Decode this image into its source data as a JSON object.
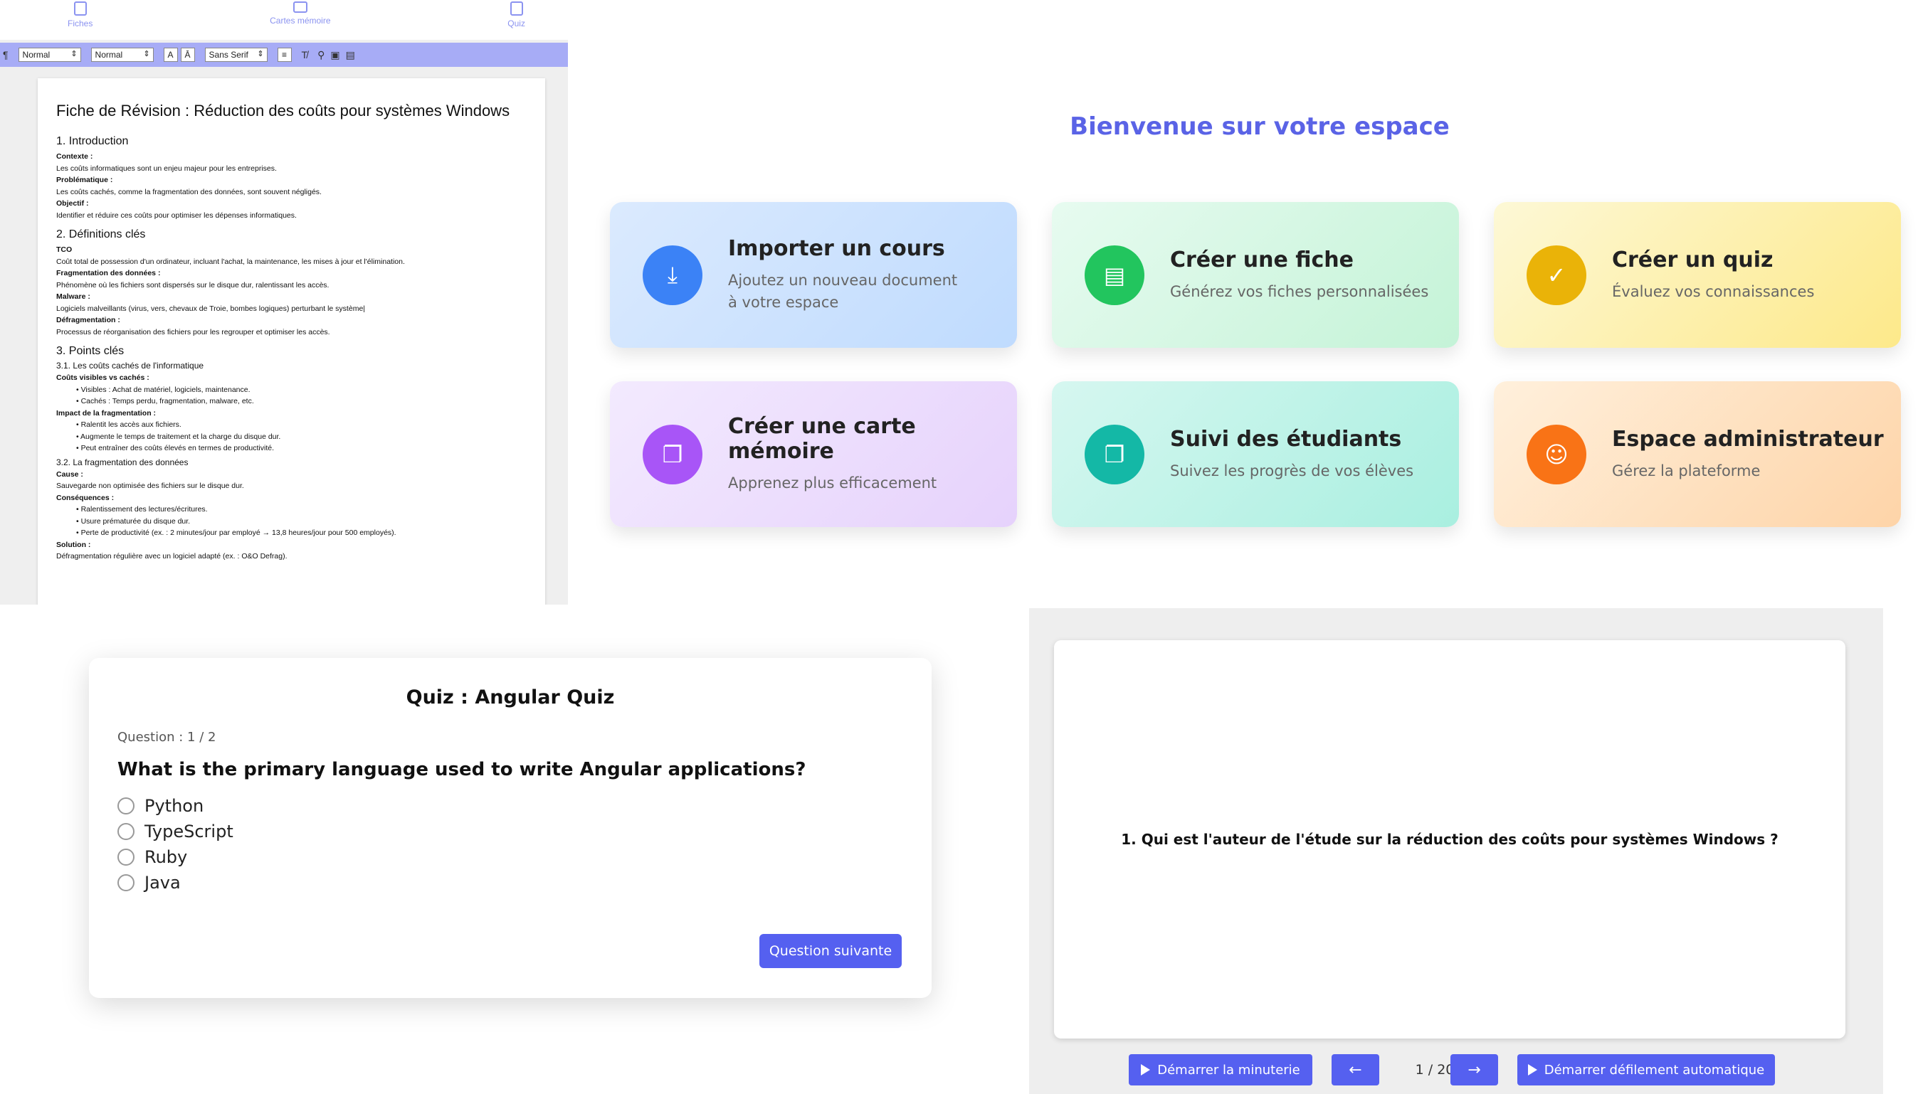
{
  "editor": {
    "nav": [
      "Fiches",
      "Cartes mémoire",
      "Quiz"
    ],
    "toolbar": {
      "heading_select": "Normal",
      "size_select": "Normal",
      "font_select": "Sans Serif"
    },
    "doc": {
      "title": "Fiche de Révision : Réduction des coûts pour systèmes Windows",
      "s1": "1. Introduction",
      "s1_lines": [
        {
          "t": "Contexte :",
          "b": true
        },
        {
          "t": "Les coûts informatiques sont un enjeu majeur pour les entreprises."
        },
        {
          "t": "Problématique :",
          "b": true
        },
        {
          "t": "Les coûts cachés, comme la fragmentation des données, sont souvent négligés."
        },
        {
          "t": "Objectif :",
          "b": true
        },
        {
          "t": "Identifier et réduire ces coûts pour optimiser les dépenses informatiques."
        }
      ],
      "s2": "2. Définitions clés",
      "s2_lines": [
        {
          "t": "TCO",
          "b": true
        },
        {
          "t": "Coût total de possession d'un ordinateur, incluant l'achat, la maintenance, les mises à jour et l'élimination."
        },
        {
          "t": "Fragmentation des données :",
          "b": true
        },
        {
          "t": "Phénomène où les fichiers sont dispersés sur le disque dur, ralentissant les accès."
        },
        {
          "t": "Malware :",
          "b": true
        },
        {
          "t": "Logiciels malveillants (virus, vers, chevaux de Troie, bombes logiques) perturbant le système|"
        },
        {
          "t": "Défragmentation :",
          "b": true
        },
        {
          "t": "Processus de réorganisation des fichiers pour les regrouper et optimiser les accès."
        }
      ],
      "s3": "3. Points clés",
      "s3_1": "3.1. Les coûts cachés de l'informatique",
      "s3_1_lines": [
        {
          "t": "Coûts visibles vs cachés :",
          "b": true
        },
        {
          "t": "• Visibles : Achat de matériel, logiciels, maintenance.",
          "i": true
        },
        {
          "t": "• Cachés : Temps perdu, fragmentation, malware, etc.",
          "i": true
        },
        {
          "t": "Impact de la fragmentation :",
          "b": true
        },
        {
          "t": "• Ralentit les accès aux fichiers.",
          "i": true
        },
        {
          "t": "• Augmente le temps de traitement et la charge du disque dur.",
          "i": true
        },
        {
          "t": "• Peut entraîner des coûts élevés en termes de productivité.",
          "i": true
        }
      ],
      "s3_2": "3.2. La fragmentation des données",
      "s3_2_lines": [
        {
          "t": "Cause :",
          "b": true
        },
        {
          "t": "Sauvegarde non optimisée des fichiers sur le disque dur."
        },
        {
          "t": "Conséquences :",
          "b": true
        },
        {
          "t": "• Ralentissement des lectures/écritures.",
          "i": true
        },
        {
          "t": "• Usure prématurée du disque dur.",
          "i": true
        },
        {
          "t": "• Perte de productivité (ex. : 2 minutes/jour par employé → 13,8 heures/jour pour 500 employés).",
          "i": true
        },
        {
          "t": "Solution :",
          "b": true
        },
        {
          "t": "Défragmentation régulière avec un logiciel adapté (ex. : O&O Defrag)."
        }
      ]
    }
  },
  "dashboard": {
    "title": "Bienvenue sur votre espace",
    "cards": [
      {
        "title": "Importer un cours",
        "desc": "Ajoutez un nouveau document à votre espace",
        "icon": "download-icon",
        "color": "#3b82f6"
      },
      {
        "title": "Créer une fiche",
        "desc": "Générez vos fiches personnalisées",
        "icon": "document-icon",
        "color": "#22c55e"
      },
      {
        "title": "Créer un quiz",
        "desc": "Évaluez vos connaissances",
        "icon": "checklist-icon",
        "color": "#eab308"
      },
      {
        "title": "Créer une carte mémoire",
        "desc": "Apprenez plus efficacement",
        "icon": "cards-icon",
        "color": "#a855f7"
      },
      {
        "title": "Suivi des étudiants",
        "desc": "Suivez les progrès de vos élèves",
        "icon": "cards-icon",
        "color": "#14b8a6"
      },
      {
        "title": "Espace administrateur",
        "desc": "Gérez la plateforme",
        "icon": "user-icon",
        "color": "#f97316"
      }
    ]
  },
  "quiz": {
    "title": "Quiz : Angular Quiz",
    "count": "Question : 1 / 2",
    "question": "What is the primary language used to write Angular applications?",
    "options": [
      "Python",
      "TypeScript",
      "Ruby",
      "Java"
    ],
    "next": "Question suivante"
  },
  "flashcards": {
    "question": "1. Qui est l'auteur de l'étude sur la réduction des coûts pour systèmes Windows ?",
    "timer_btn": "Démarrer la minuterie",
    "prev": "←",
    "counter": "1 / 20",
    "next": "→",
    "auto_btn": "Démarrer défilement automatique"
  }
}
